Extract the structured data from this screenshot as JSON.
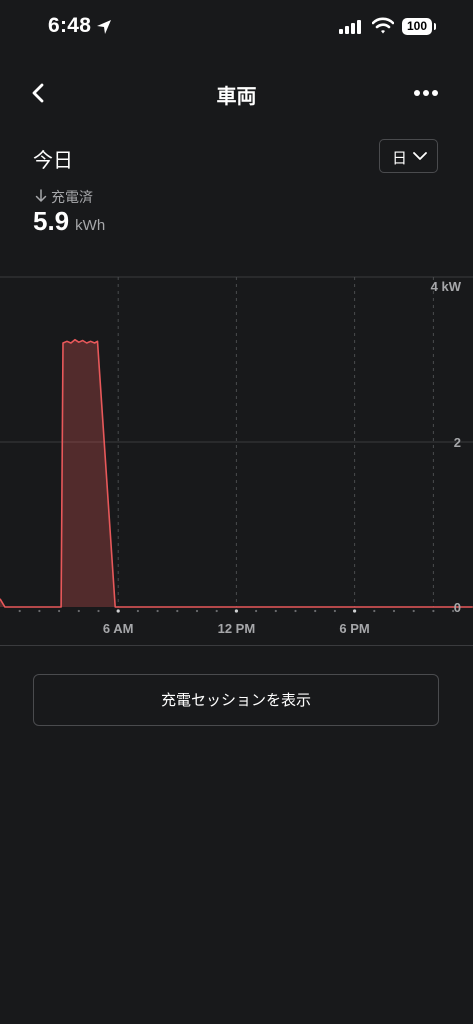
{
  "status_bar": {
    "time": "6:48",
    "battery": "100"
  },
  "nav": {
    "title": "車両"
  },
  "period": {
    "title": "今日",
    "selector_value": "日"
  },
  "stat": {
    "label": "充電済",
    "value": "5.9",
    "unit": "kWh"
  },
  "chart_data": {
    "type": "area",
    "series": [
      {
        "x": [
          0.0,
          0.25,
          3.0,
          3.1,
          3.2,
          3.4,
          3.6,
          3.8,
          4.0,
          4.2,
          4.4,
          4.6,
          4.8,
          4.95,
          5.85,
          6.0,
          24.0
        ],
        "values": [
          0.1,
          0.0,
          0.0,
          0.0,
          3.2,
          3.22,
          3.2,
          3.24,
          3.21,
          3.23,
          3.2,
          3.22,
          3.2,
          3.22,
          0.0,
          0.0,
          0.0
        ]
      }
    ],
    "ylim": [
      0,
      4
    ],
    "xlim": [
      0,
      24
    ],
    "y_ticks": [
      "4 kW",
      "2",
      "0"
    ],
    "x_ticks": [
      "6 AM",
      "12 PM",
      "6 PM"
    ],
    "color": "#e8585a",
    "grid": true
  },
  "actions": {
    "sessions_button": "充電セッションを表示"
  }
}
